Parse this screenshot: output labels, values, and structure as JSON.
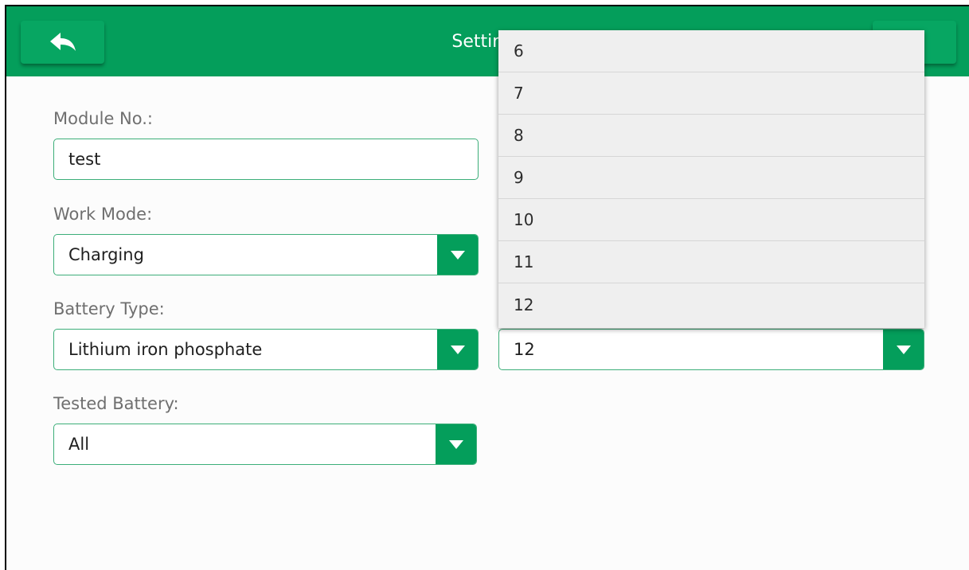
{
  "header": {
    "title": "Settings",
    "back_icon": "back-arrow-icon"
  },
  "form": {
    "module_no": {
      "label": "Module No.:",
      "value": "test"
    },
    "work_mode": {
      "label": "Work Mode:",
      "value": "Charging"
    },
    "battery_type": {
      "label": "Battery Type:",
      "value": "Lithium iron phosphate"
    },
    "tested_battery": {
      "label": "Tested Battery:",
      "value": "All"
    },
    "right_select": {
      "value": "12"
    }
  },
  "dropdown": {
    "options": [
      "6",
      "7",
      "8",
      "9",
      "10",
      "11",
      "12"
    ]
  },
  "colors": {
    "accent": "#049e5b",
    "field_border": "#3cae79",
    "dropdown_bg": "#efefef"
  }
}
